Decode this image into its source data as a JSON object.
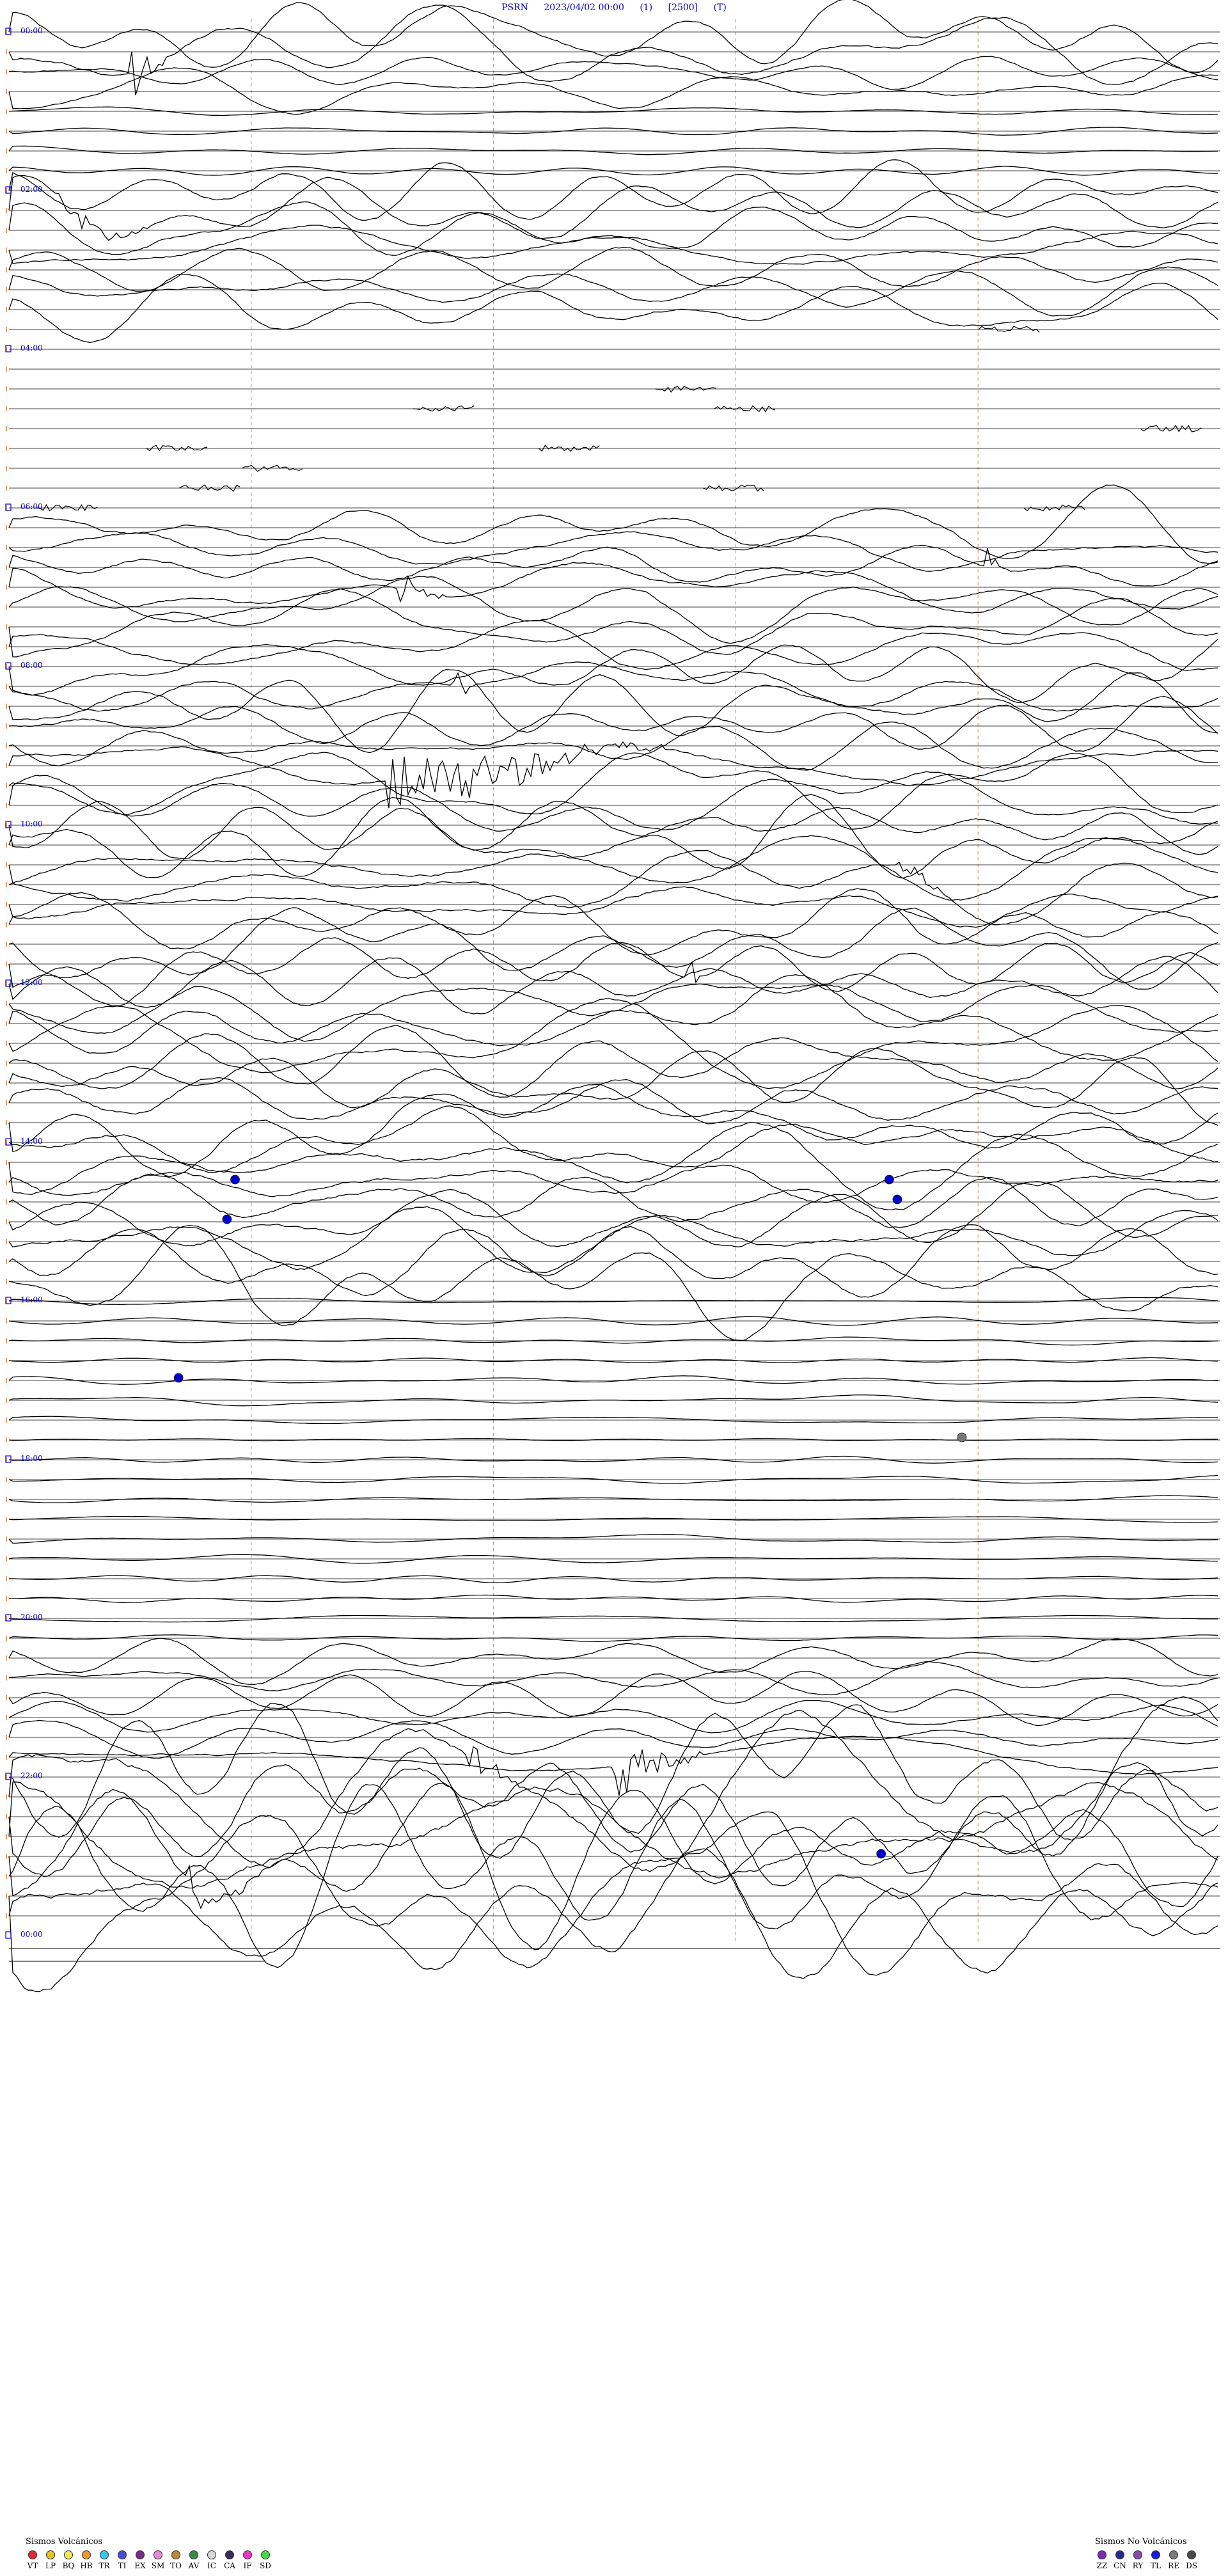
{
  "header": {
    "station": "PSRN",
    "datetime": "2023/04/02 00:00",
    "param1": "(1)",
    "param2": "[2500]",
    "param3": "(T)"
  },
  "chart_data": {
    "type": "line",
    "title": "PSRN 2023/04/02 00:00 (1) [2500] (T)",
    "time_labels": [
      "00:00",
      "02:00",
      "04:00",
      "06:00",
      "08:00",
      "10:00",
      "12:00",
      "14:00",
      "16:00",
      "18:00",
      "20:00",
      "22:00",
      "00:00"
    ],
    "rows_per_label": 8,
    "row_minutes": 15,
    "minute_markers": [
      0,
      3,
      6,
      9,
      12
    ],
    "event_markers": [
      {
        "row": 58,
        "minute": 2.8,
        "color": "#0000cc"
      },
      {
        "row": 60,
        "minute": 2.7,
        "color": "#0000cc"
      },
      {
        "row": 58,
        "minute": 10.9,
        "color": "#0000cc"
      },
      {
        "row": 59,
        "minute": 11.0,
        "color": "#0000cc"
      },
      {
        "row": 68,
        "minute": 2.1,
        "color": "#0000cc"
      },
      {
        "row": 71,
        "minute": 11.8,
        "color": "#777777"
      },
      {
        "row": 92,
        "minute": 10.8,
        "color": "#0000cc"
      }
    ],
    "activity": [
      {
        "start": 0,
        "end": 2,
        "level": 0.8
      },
      {
        "start": 2,
        "end": 4,
        "level": 0.45
      },
      {
        "start": 8,
        "end": 15,
        "level": 0.65
      },
      {
        "start": 15,
        "end": 25,
        "level": 0.05
      },
      {
        "start": 25,
        "end": 40,
        "level": 0.7
      },
      {
        "start": 40,
        "end": 54,
        "level": 0.8
      },
      {
        "start": 54,
        "end": 64,
        "level": 0.9
      },
      {
        "start": 64,
        "end": 82,
        "level": 0.08
      },
      {
        "start": 82,
        "end": 88,
        "level": 0.5
      },
      {
        "start": 88,
        "end": 98,
        "level": 1.7
      },
      {
        "start": 98,
        "end": 120,
        "level": 1.1
      }
    ],
    "bursts": [
      {
        "row": 1,
        "minute": 1.5,
        "width": 0.5,
        "amp": 1.5
      },
      {
        "row": 9,
        "minute": 0.6,
        "width": 1.2,
        "amp": 0.6
      },
      {
        "row": 28,
        "minute": 4.8,
        "width": 0.6,
        "amp": 0.9
      },
      {
        "row": 27,
        "minute": 12.1,
        "width": 0.3,
        "amp": 1.3
      },
      {
        "row": 33,
        "minute": 5.5,
        "width": 0.3,
        "amp": 0.9
      },
      {
        "row": 37,
        "minute": 4.7,
        "width": 3.4,
        "amp": 1.6
      },
      {
        "row": 43,
        "minute": 11.0,
        "width": 0.7,
        "amp": 0.6
      },
      {
        "row": 47,
        "minute": 8.4,
        "width": 0.15,
        "amp": 1.4
      },
      {
        "row": 87,
        "minute": 7.5,
        "width": 1.1,
        "amp": 1.6
      },
      {
        "row": 89,
        "minute": 5.7,
        "width": 0.6,
        "amp": 0.8
      },
      {
        "row": 92,
        "minute": 2.2,
        "width": 0.9,
        "amp": 1.0
      }
    ]
  },
  "legend_volcanic": {
    "title": "Sismos Volcánicos",
    "items": [
      {
        "label": "VT",
        "color": "#e8282c"
      },
      {
        "label": "LP",
        "color": "#e8c21f"
      },
      {
        "label": "BQ",
        "color": "#f2e85a"
      },
      {
        "label": "HB",
        "color": "#f0952a"
      },
      {
        "label": "TR",
        "color": "#36c8e8"
      },
      {
        "label": "TI",
        "color": "#4a4ad8"
      },
      {
        "label": "EX",
        "color": "#7a2a8a"
      },
      {
        "label": "SM",
        "color": "#e88ad8"
      },
      {
        "label": "TO",
        "color": "#b88a3a"
      },
      {
        "label": "AV",
        "color": "#3a8a4a"
      },
      {
        "label": "IC",
        "color": "#d8d8d8"
      },
      {
        "label": "CA",
        "color": "#3a2a5a"
      },
      {
        "label": "IF",
        "color": "#e83ac8"
      },
      {
        "label": "SD",
        "color": "#4ad84a"
      }
    ]
  },
  "legend_nonvolcanic": {
    "title": "Sismos No Volcánicos",
    "items": [
      {
        "label": "ZZ",
        "color": "#7a2ab8"
      },
      {
        "label": "CN",
        "color": "#2a2a8a"
      },
      {
        "label": "RY",
        "color": "#8a4aa8"
      },
      {
        "label": "TL",
        "color": "#1a1ad8"
      },
      {
        "label": "RE",
        "color": "#7a7a7a"
      },
      {
        "label": "DS",
        "color": "#4a4a4a"
      }
    ]
  }
}
